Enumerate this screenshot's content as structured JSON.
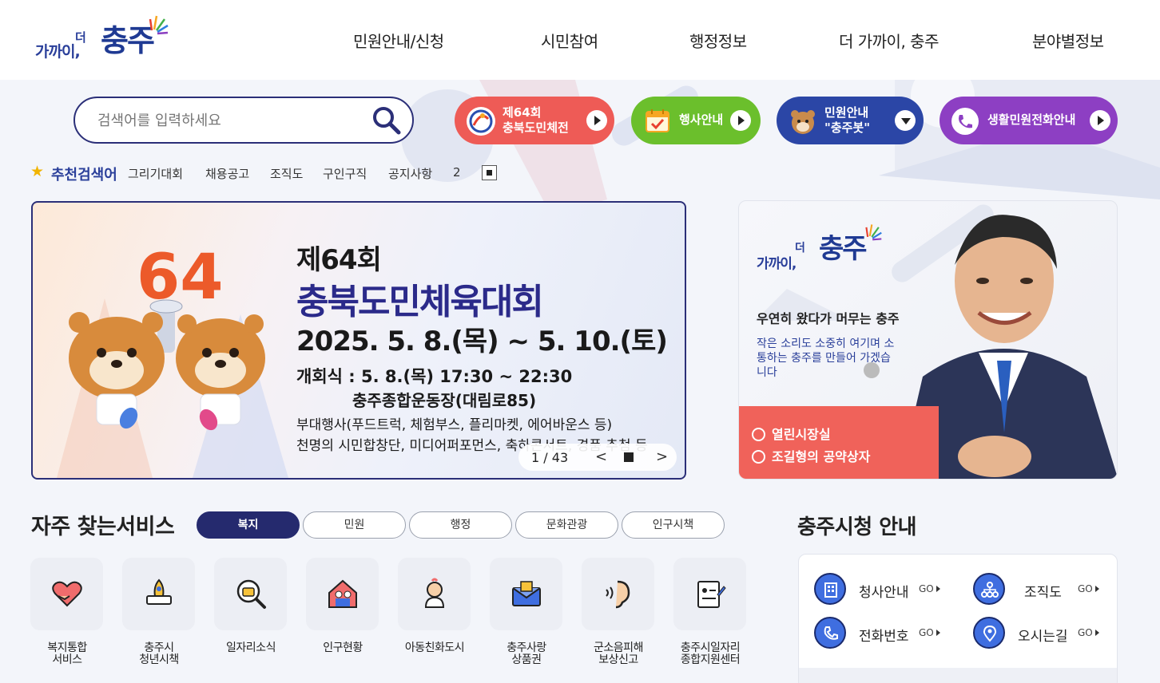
{
  "header": {
    "logo": {
      "small": "가까이,",
      "tiny": "더",
      "big": "충주"
    },
    "nav": [
      "민원안내/신청",
      "시민참여",
      "행정정보",
      "더 가까이, 충주",
      "분야별정보"
    ]
  },
  "search": {
    "placeholder": "검색어를 입력하세요",
    "icon": "search-icon"
  },
  "quick_links": [
    {
      "label_line1": "제64회",
      "label_line2": "충북도민체전",
      "color": "#ee5b56"
    },
    {
      "label_line1": "행사안내",
      "label_line2": "",
      "color": "#6bbf2c"
    },
    {
      "label_line1": "민원안내",
      "label_line2": "\"충주봇\"",
      "color": "#2b46a6"
    },
    {
      "label_line1": "생활민원전화안내",
      "label_line2": "",
      "color": "#8d3fc3"
    }
  ],
  "recommended": {
    "title": "추천검색어",
    "keywords": [
      "그리기대회",
      "채용공고",
      "조직도",
      "구인구직",
      "공지사항",
      "2"
    ]
  },
  "banner": {
    "edition": "제64회",
    "title": "충북도민체육대회",
    "date": "2025. 5. 8.(목) ~ 5. 10.(토)",
    "ceremony": "개회식 : 5. 8.(목) 17:30 ~ 22:30",
    "venue": "충주종합운동장(대림로85)",
    "events1": "부대행사(푸드트럭, 체험부스, 플리마켓, 에어바운스 등)",
    "events2": "천명의 시민합창단, 미디어퍼포먼스, 축하콘서트, 경품 추첨 등",
    "mascot_text": "64",
    "pager": {
      "current": "1",
      "separator": "/",
      "total": "43"
    }
  },
  "mayor": {
    "logo": {
      "small": "가까이,",
      "tiny": "더",
      "big": "충주"
    },
    "tagline": "우연히 왔다가 머무는 충주",
    "description": "작은 소리도 소중히 여기며 소통하는 충주를 만들어 가겠습니다",
    "links": [
      "열린시장실",
      "조길형의 공약상자"
    ]
  },
  "services": {
    "title": "자주 찾는서비스",
    "tabs": [
      "복지",
      "민원",
      "행정",
      "문화관광",
      "인구시책"
    ],
    "active_tab": "복지",
    "items": [
      {
        "label": "복지통합\n서비스",
        "icon": "heart-hands-icon"
      },
      {
        "label": "충주시\n청년시책",
        "icon": "rocket-laptop-icon"
      },
      {
        "label": "일자리소식",
        "icon": "magnifier-briefcase-icon"
      },
      {
        "label": "인구현황",
        "icon": "house-people-icon"
      },
      {
        "label": "아동친화도시",
        "icon": "child-icon"
      },
      {
        "label": "충주사랑\n상품권",
        "icon": "gift-envelope-icon"
      },
      {
        "label": "군소음피해\n보상신고",
        "icon": "ear-sound-icon"
      },
      {
        "label": "충주시일자리\n종합지원센터",
        "icon": "clipboard-pen-icon"
      }
    ]
  },
  "cityhall": {
    "title": "충주시청 안내",
    "go": "GO",
    "items": [
      {
        "label": "청사안내",
        "icon": "building-icon"
      },
      {
        "label": "조직도",
        "icon": "org-chart-icon"
      },
      {
        "label": "전화번호",
        "icon": "phone-icon"
      },
      {
        "label": "오시는길",
        "icon": "location-pin-icon"
      }
    ]
  },
  "colors": {
    "primary_navy": "#252a6e",
    "brand_blue": "#2a3f9a",
    "accent_red": "#f0625a"
  }
}
